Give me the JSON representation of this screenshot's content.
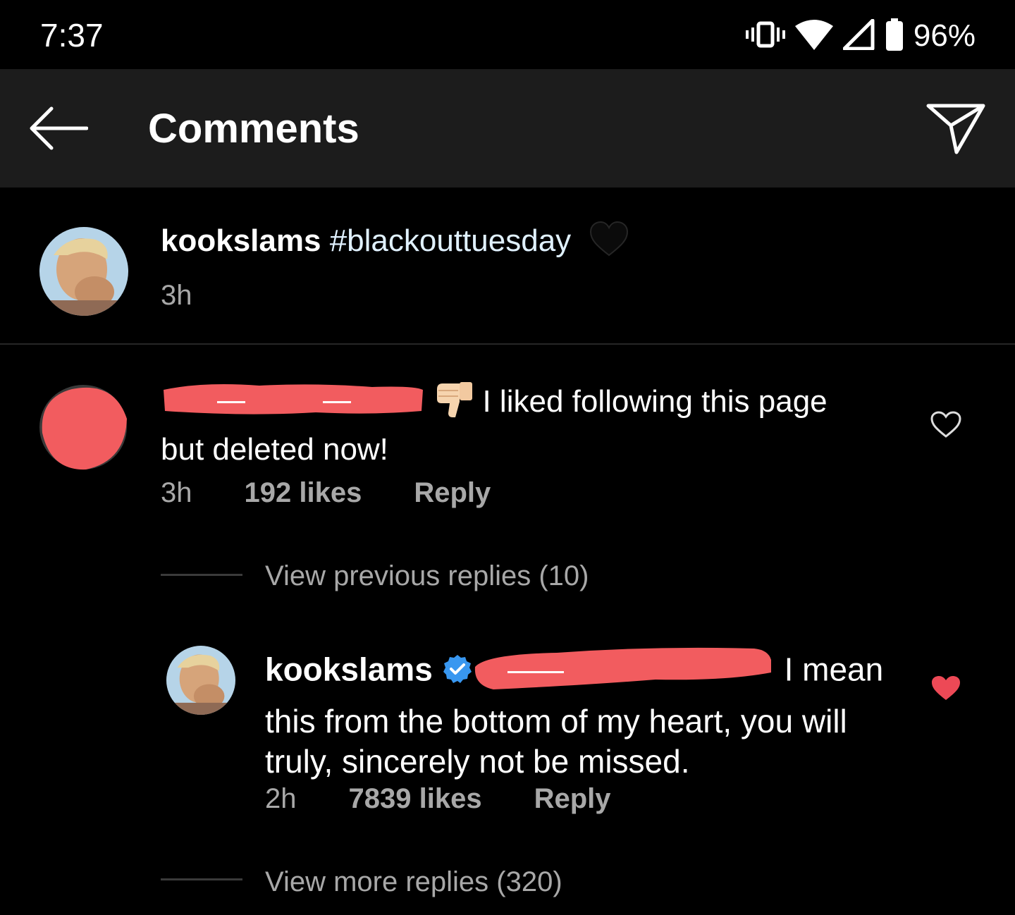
{
  "status_bar": {
    "time": "7:37",
    "battery_percent": "96%",
    "icons": [
      "vibrate-icon",
      "wifi-icon",
      "cell-signal-icon",
      "battery-icon"
    ]
  },
  "app_bar": {
    "title": "Comments",
    "back_icon": "arrow-left-icon",
    "share_icon": "paper-plane-icon"
  },
  "caption": {
    "username": "kookslams",
    "hashtag": "#blackouttuesday",
    "emoji": "black-heart-emoji",
    "time": "3h"
  },
  "comments": [
    {
      "username": "[redacted]",
      "emoji": "thumbs-down-emoji",
      "text": "I liked following this page",
      "text_cont": "but deleted now!",
      "time": "3h",
      "likes": "192 likes",
      "reply_label": "Reply",
      "liked": false,
      "view_previous_replies": "View previous replies (10)",
      "replies": [
        {
          "username": "kookslams",
          "verified": true,
          "mention": "[redacted]",
          "text_line1_end": "I mean",
          "text_rest": "this from the bottom of my heart, you will truly, sincerely not be missed.",
          "time": "2h",
          "likes": "7839 likes",
          "reply_label": "Reply",
          "liked": true
        }
      ],
      "view_more_replies": "View more replies (320)"
    }
  ],
  "colors": {
    "background": "#000000",
    "app_bar": "#1c1c1c",
    "secondary_text": "#a8a8a8",
    "liked_heart": "#ed4956",
    "verified_badge": "#3897f0",
    "redaction": "#f25c5f"
  }
}
